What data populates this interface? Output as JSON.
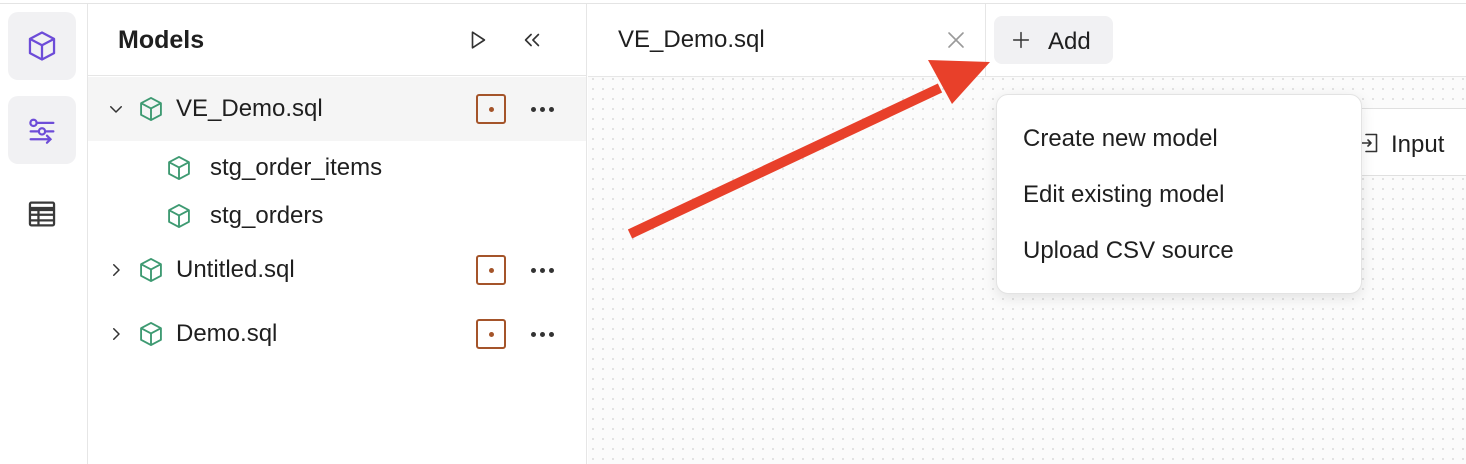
{
  "panel": {
    "title": "Models",
    "run_icon": "play-icon",
    "collapse_icon": "double-chevron-left-icon"
  },
  "tree": [
    {
      "label": "VE_Demo.sql",
      "expanded": true,
      "children": [
        "stg_order_items",
        "stg_orders"
      ]
    },
    {
      "label": "Untitled.sql",
      "expanded": false
    },
    {
      "label": "Demo.sql",
      "expanded": false
    }
  ],
  "tab": {
    "label": "VE_Demo.sql"
  },
  "add_button": {
    "label": "Add"
  },
  "node": {
    "label": "Input"
  },
  "menu": {
    "items": [
      "Create new model",
      "Edit existing model",
      "Upload CSV source"
    ]
  },
  "colors": {
    "accent_purple": "#6d4cd8",
    "model_green": "#3e9a72",
    "badge_brown": "#a4542a",
    "annotation_red": "#e8402a"
  }
}
